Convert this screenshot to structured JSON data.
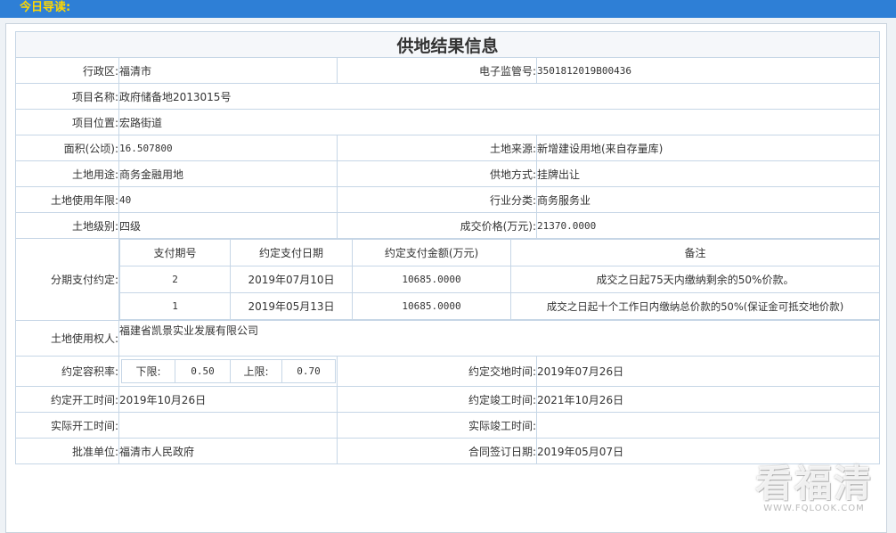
{
  "topbar": {
    "title": "今日导读:"
  },
  "doc": {
    "title": "供地结果信息",
    "district": {
      "label": "行政区:",
      "value": "福清市"
    },
    "supervision_no": {
      "label": "电子监管号:",
      "value": "3501812019B00436"
    },
    "project_name": {
      "label": "项目名称:",
      "value": "政府储备地2013015号"
    },
    "project_location": {
      "label": "项目位置:",
      "value": "宏路街道"
    },
    "area": {
      "label": "面积(公顷):",
      "value": "16.507800"
    },
    "land_source": {
      "label": "土地来源:",
      "value": "新增建设用地(来自存量库)"
    },
    "land_use": {
      "label": "土地用途:",
      "value": "商务金融用地"
    },
    "supply_method": {
      "label": "供地方式:",
      "value": "挂牌出让"
    },
    "use_years": {
      "label": "土地使用年限:",
      "value": "40"
    },
    "industry": {
      "label": "行业分类:",
      "value": "商务服务业"
    },
    "land_grade": {
      "label": "土地级别:",
      "value": "四级"
    },
    "price": {
      "label": "成交价格(万元):",
      "value": "21370.0000"
    },
    "installments": {
      "label": "分期支付约定:",
      "headers": [
        "支付期号",
        "约定支付日期",
        "约定支付金额(万元)",
        "备注"
      ],
      "rows": [
        [
          "2",
          "2019年07月10日",
          "10685.0000",
          "成交之日起75天内缴纳剩余的50%价款。"
        ],
        [
          "1",
          "2019年05月13日",
          "10685.0000",
          "成交之日起十个工作日内缴纳总价款的50%(保证金可抵交地价款)"
        ]
      ]
    },
    "land_owner": {
      "label": "土地使用权人:",
      "value": "福建省凯景实业发展有限公司"
    },
    "plot_ratio": {
      "label": "约定容积率:",
      "lower_label": "下限:",
      "lower_value": "0.50",
      "upper_label": "上限:",
      "upper_value": "0.70"
    },
    "delivery_time": {
      "label": "约定交地时间:",
      "value": "2019年07月26日"
    },
    "start_time": {
      "label": "约定开工时间:",
      "value": "2019年10月26日"
    },
    "completion_time": {
      "label": "约定竣工时间:",
      "value": "2021年10月26日"
    },
    "actual_start": {
      "label": "实际开工时间:",
      "value": ""
    },
    "actual_completion": {
      "label": "实际竣工时间:",
      "value": ""
    },
    "approval_unit": {
      "label": "批准单位:",
      "value": "福清市人民政府"
    },
    "contract_date": {
      "label": "合同签订日期:",
      "value": "2019年05月07日"
    }
  },
  "watermark": {
    "text": "看福清",
    "url": "WWW.FQLOOK.COM"
  }
}
